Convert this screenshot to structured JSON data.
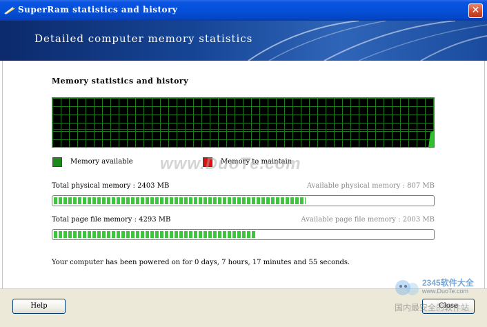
{
  "window": {
    "title": "SuperRam statistics and history",
    "close_glyph": "✕"
  },
  "banner": {
    "heading": "Detailed computer memory statistics"
  },
  "section": {
    "title": "Memory statistics and history"
  },
  "legend": {
    "available": {
      "label": "Memory available",
      "color": "#1a8a1a"
    },
    "maintain": {
      "label": "Memory to maintain",
      "color": "#e01010"
    }
  },
  "stats": {
    "physical": {
      "total_label": "Total physical memory : 2403 MB",
      "available_label": "Available physical memory : 807 MB",
      "bar_fraction": 0.665
    },
    "pagefile": {
      "total_label": "Total page file memory : 4293 MB",
      "available_label": "Available page file memory : 2003 MB",
      "bar_fraction": 0.535
    }
  },
  "uptime": "Your computer has been powered on for 0 days, 7 hours, 17 minutes and 55 seconds.",
  "buttons": {
    "help": "Help",
    "close": "Close"
  },
  "watermarks": {
    "center": "www.DuoTe.com",
    "corner_brand": "2345软件大全",
    "corner_url": "www.DuoTe.com",
    "corner_caption": "国内最安全的软件站"
  },
  "colors": {
    "graph_grid": "#1f7a1f",
    "bar_fill": "#3ec43e",
    "titlebar": "#0550d9"
  }
}
